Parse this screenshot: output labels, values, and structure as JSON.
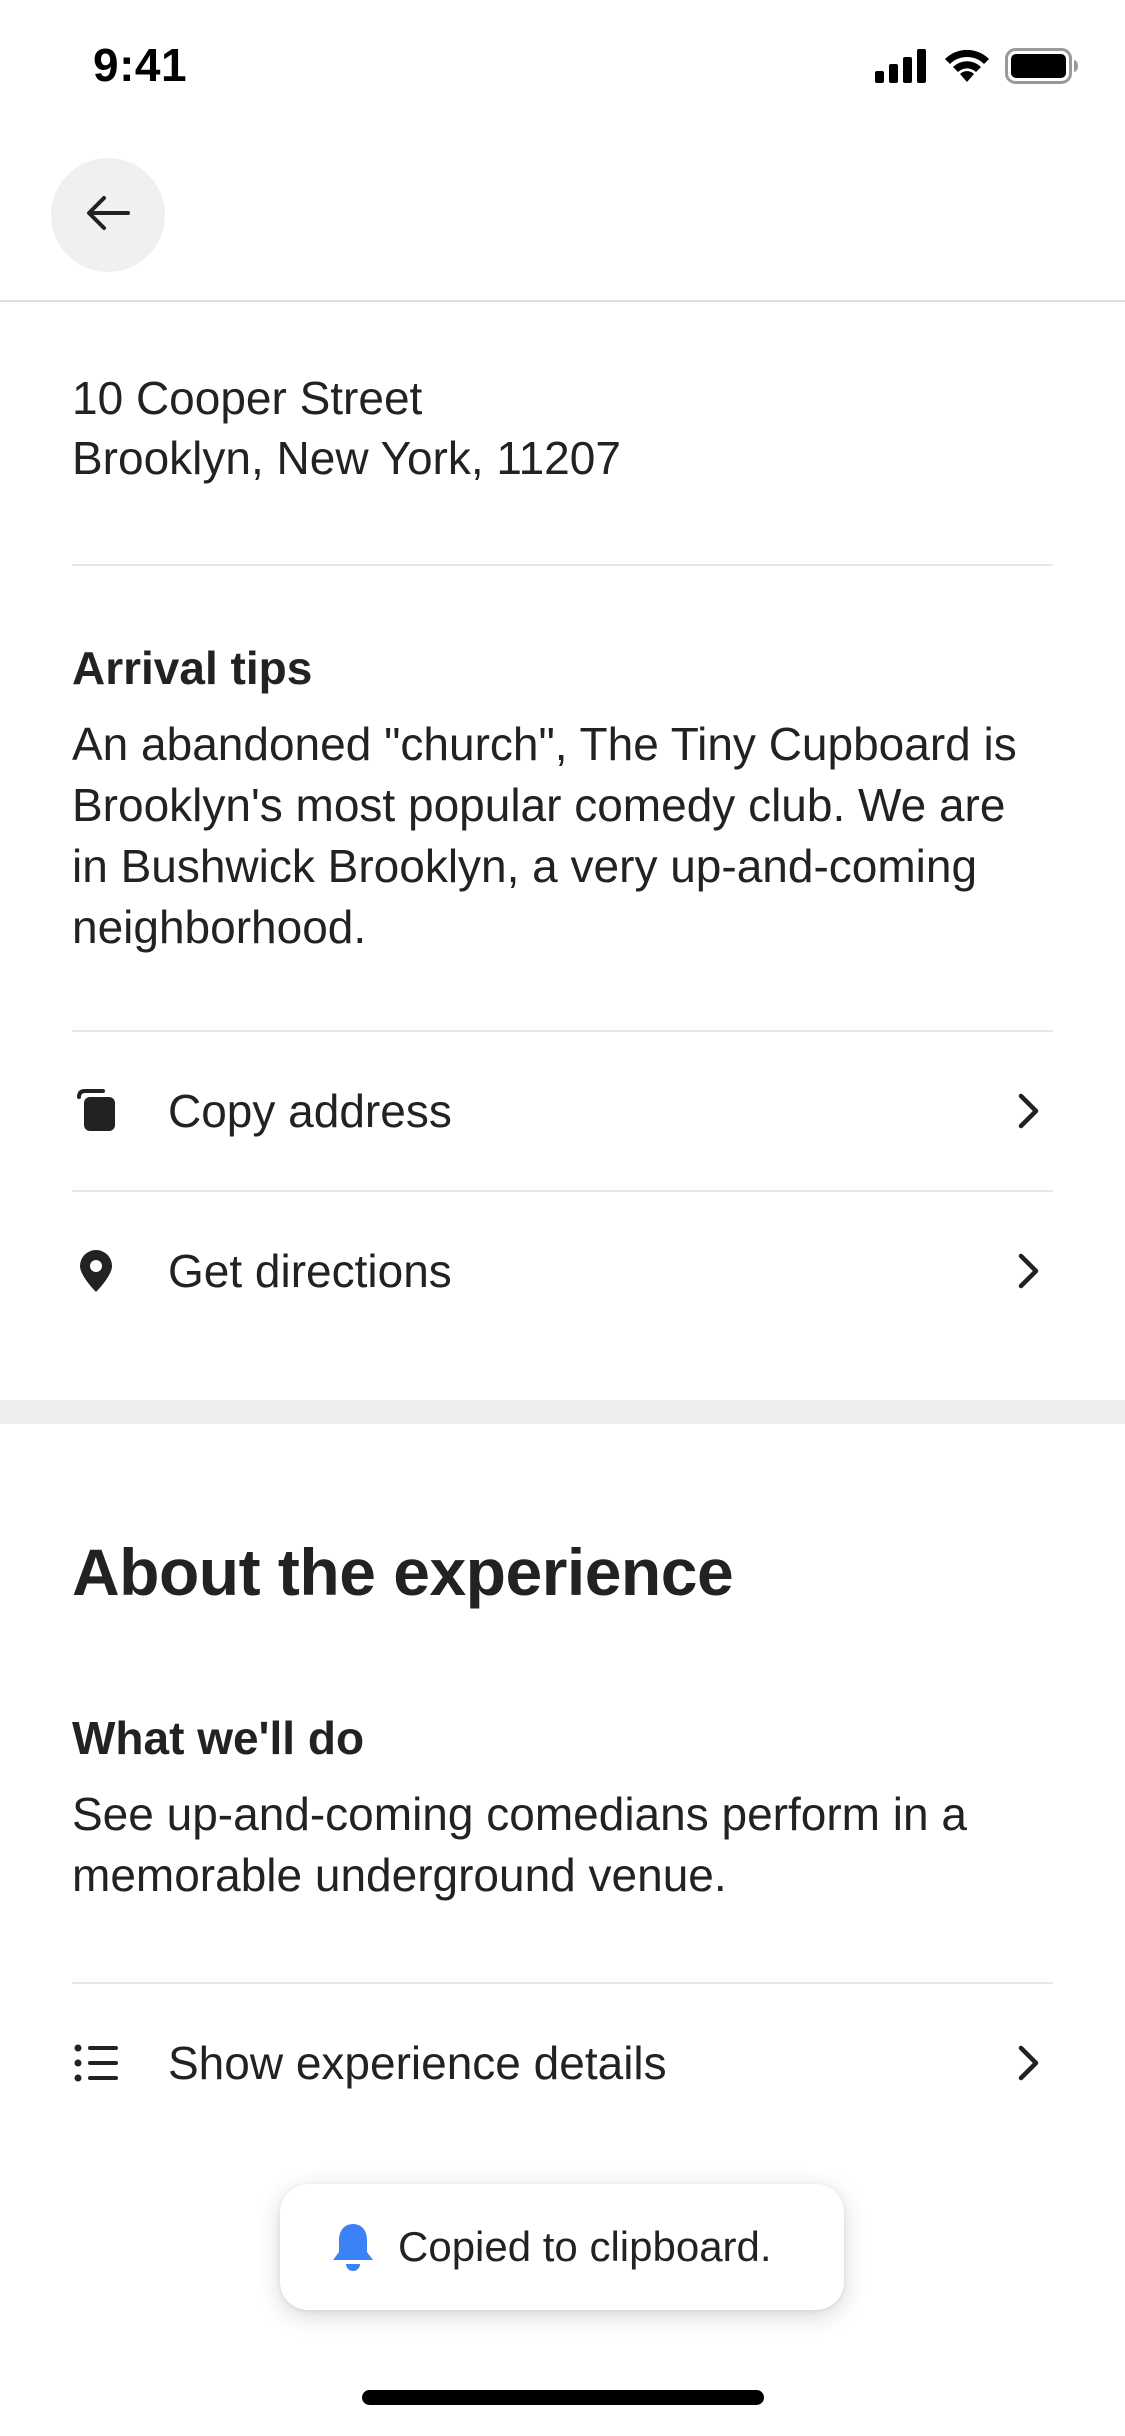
{
  "status_bar": {
    "time": "9:41"
  },
  "header": {
    "back_icon": "arrow-left-icon"
  },
  "address": {
    "line1": "10 Cooper Street",
    "line2": "Brooklyn, New York, 11207"
  },
  "arrival_tips": {
    "title": "Arrival tips",
    "text": "An abandoned \"church\", The Tiny Cupboard is Brooklyn's most popular comedy club. We are in Bushwick Brooklyn, a very up-and-coming neighborhood."
  },
  "actions": {
    "copy_address": {
      "label": "Copy address",
      "icon": "copy-icon"
    },
    "get_directions": {
      "label": "Get directions",
      "icon": "map-pin-icon"
    }
  },
  "about": {
    "title": "About the experience",
    "what_title": "What we'll do",
    "what_text": "See up-and-coming comedians perform in a memorable underground venue.",
    "details_label": "Show experience details",
    "details_icon": "list-icon"
  },
  "toast": {
    "text": "Copied to clipboard.",
    "icon": "bell-icon",
    "icon_color": "#3B82F6"
  },
  "colors": {
    "text": "#222222",
    "divider": "#E6E6E6",
    "band": "#EDEDED",
    "back_button_bg": "#F0F0F0"
  }
}
